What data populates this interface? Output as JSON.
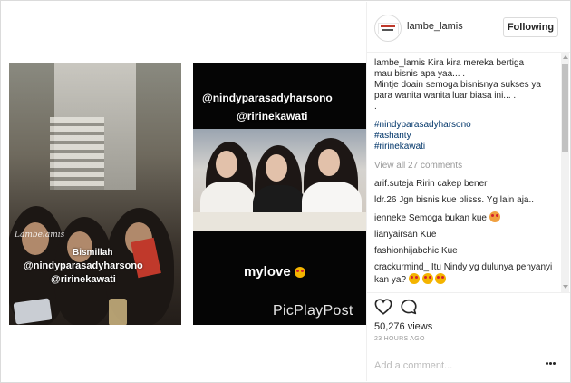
{
  "post": {
    "username": "lambe_lamis",
    "follow_label": "Following"
  },
  "media": {
    "left_watermark": "Lambelamis",
    "left_overlay": [
      "Bismillah",
      "@nindyparasadyharsono",
      "@ririnekawati"
    ],
    "right_tags": [
      "@nindyparasadyharsono",
      "@ririnekawati"
    ],
    "right_caption": "mylove",
    "right_brand": "PicPlayPost"
  },
  "caption": {
    "username": "lambe_lamis",
    "text_line1": "Kira kira mereka bertiga",
    "text_line2": "mau bisnis apa yaa... .",
    "text_line3": "Mintje doain semoga bisnisnya sukses ya",
    "text_line4": "para wanita wanita luar biasa ini... .",
    "text_line5": ".",
    "hashtags": [
      "#nindyparasadyharsono",
      "#ashanty",
      "#ririnekawati"
    ]
  },
  "view_all_comments": "View all 27 comments",
  "comments": [
    {
      "user": "arif.suteja",
      "text": "Ririn cakep bener"
    },
    {
      "user": "ldr.26",
      "text": "Jgn bisnis kue plisss. Yg lain aja.."
    },
    {
      "user": "ienneke",
      "text": "Semoga bukan kue"
    },
    {
      "user": "lianyairsan",
      "text": "Kue"
    },
    {
      "user": "fashionhijabchic",
      "text": "Kue"
    },
    {
      "user": "crackurmind_",
      "text": "Itu Nindy yg dulunya penyanyi kan ya?"
    }
  ],
  "stats": {
    "views": "50,276 views",
    "time": "23 HOURS AGO"
  },
  "add_comment": {
    "placeholder": "Add a comment..."
  },
  "icons": {
    "like": "heart-icon",
    "comment": "comment-icon",
    "more": "more-options-icon"
  }
}
